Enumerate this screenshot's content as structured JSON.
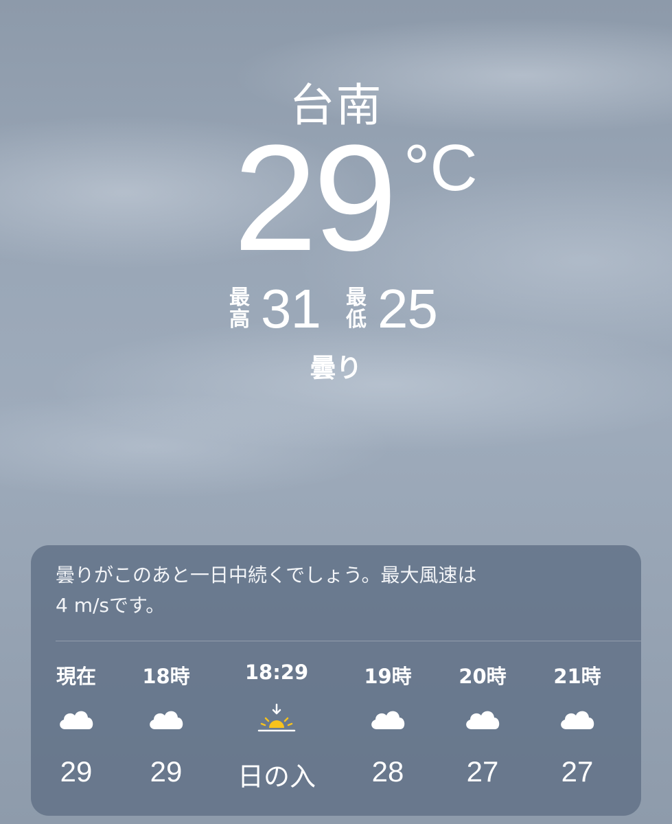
{
  "location": {
    "city": "台南",
    "temperature": "29",
    "unit": "°C",
    "high_label": "最高",
    "high": "31",
    "low_label": "最低",
    "low": "25",
    "condition": "曇り"
  },
  "forecast": {
    "summary_line1": "曇りがこのあと一日中続くでしょう。最大風速は",
    "summary_line2": "4 m/sです。",
    "hours": [
      {
        "label": "現在",
        "icon": "cloud-icon",
        "value": "29"
      },
      {
        "label": "18時",
        "icon": "cloud-icon",
        "value": "29"
      },
      {
        "label": "18:29",
        "icon": "sunset-icon",
        "value": "日の入"
      },
      {
        "label": "19時",
        "icon": "cloud-icon",
        "value": "28"
      },
      {
        "label": "20時",
        "icon": "cloud-icon",
        "value": "27"
      },
      {
        "label": "21時",
        "icon": "cloud-icon",
        "value": "27"
      }
    ]
  },
  "colors": {
    "card_background": "#607086",
    "sun": "#f7c21d",
    "text": "#ffffff"
  }
}
